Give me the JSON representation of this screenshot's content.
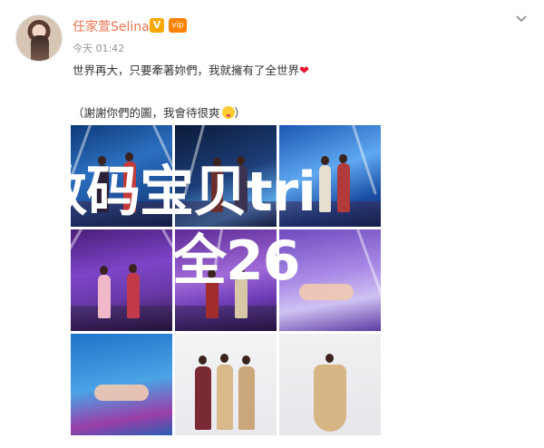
{
  "post": {
    "username": "任家萱Selina",
    "verified_badge": "V",
    "vip_badge": "vip",
    "time": "今天 01:42",
    "source": "",
    "lines": [
      "世界再大，只要牽著妳們，我就擁有了全世界",
      "謝謝你們的圖，我會待很爽"
    ],
    "heart": "❤",
    "quote_open": "（",
    "quote_close": "）"
  },
  "menu": {
    "icon": "chevron-down-icon"
  },
  "watermark": {
    "line1": "数码宝贝tri",
    "line2": "全26"
  },
  "colors": {
    "username": "#eb7350",
    "badge_v": "#f7a800",
    "heart": "#e6162d"
  }
}
